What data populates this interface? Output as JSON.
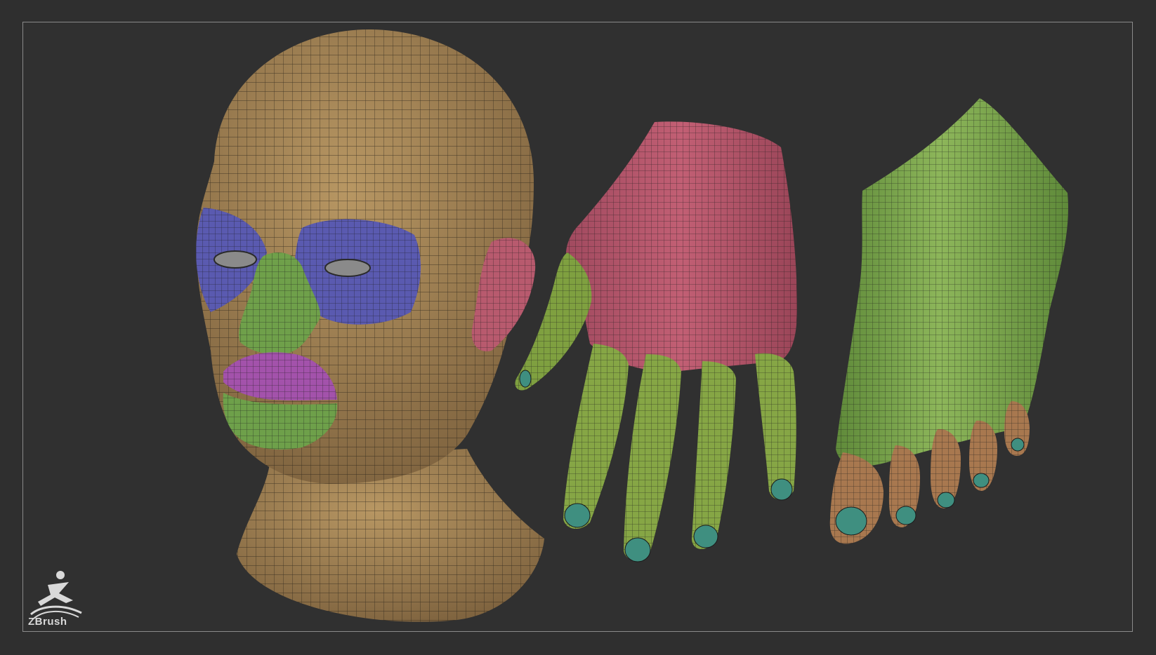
{
  "viewport": {
    "background": "#303030",
    "frame_color": "#8a8a8a"
  },
  "models": {
    "head": {
      "base_color": "#9c7c4f",
      "eye_region_color": "#5555a6",
      "nose_cheek_color": "#6e9d4a",
      "lips_color": "#a052a8",
      "ear_color": "#b4566a"
    },
    "hand": {
      "palm_color": "#b4566a",
      "finger_color": "#7f9d3f",
      "nail_color": "#3f8f80"
    },
    "foot": {
      "base_color": "#7aa24a",
      "toe_color": "#a8784f",
      "nail_color": "#3f8f80"
    }
  },
  "branding": {
    "logo_text": "ZBrush",
    "logo_icon": "zbrush-runner-icon"
  }
}
